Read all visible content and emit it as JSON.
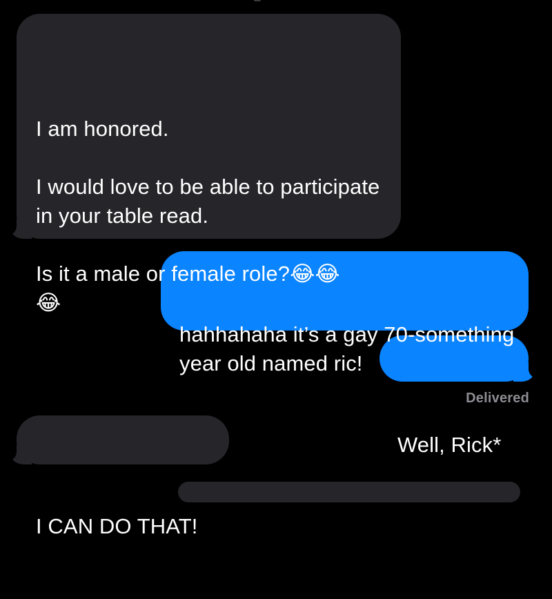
{
  "messages": [
    {
      "direction": "incoming",
      "text": "I am honored.\n\nI would love to be able to participate in your table read.\n\nIs it a male or female role?😂😂\n😂"
    },
    {
      "direction": "outgoing",
      "text": "hahhahaha it’s a gay 70-something year old named ric!"
    },
    {
      "direction": "outgoing",
      "text": "Well, Rick*"
    },
    {
      "direction": "incoming",
      "text": "I CAN DO THAT!"
    }
  ],
  "status": {
    "label": "Delivered"
  },
  "colors": {
    "background": "#000000",
    "incoming_bubble": "#26252a",
    "outgoing_bubble": "#0a84ff",
    "text": "#ffffff",
    "status_text": "#8d8d93"
  }
}
